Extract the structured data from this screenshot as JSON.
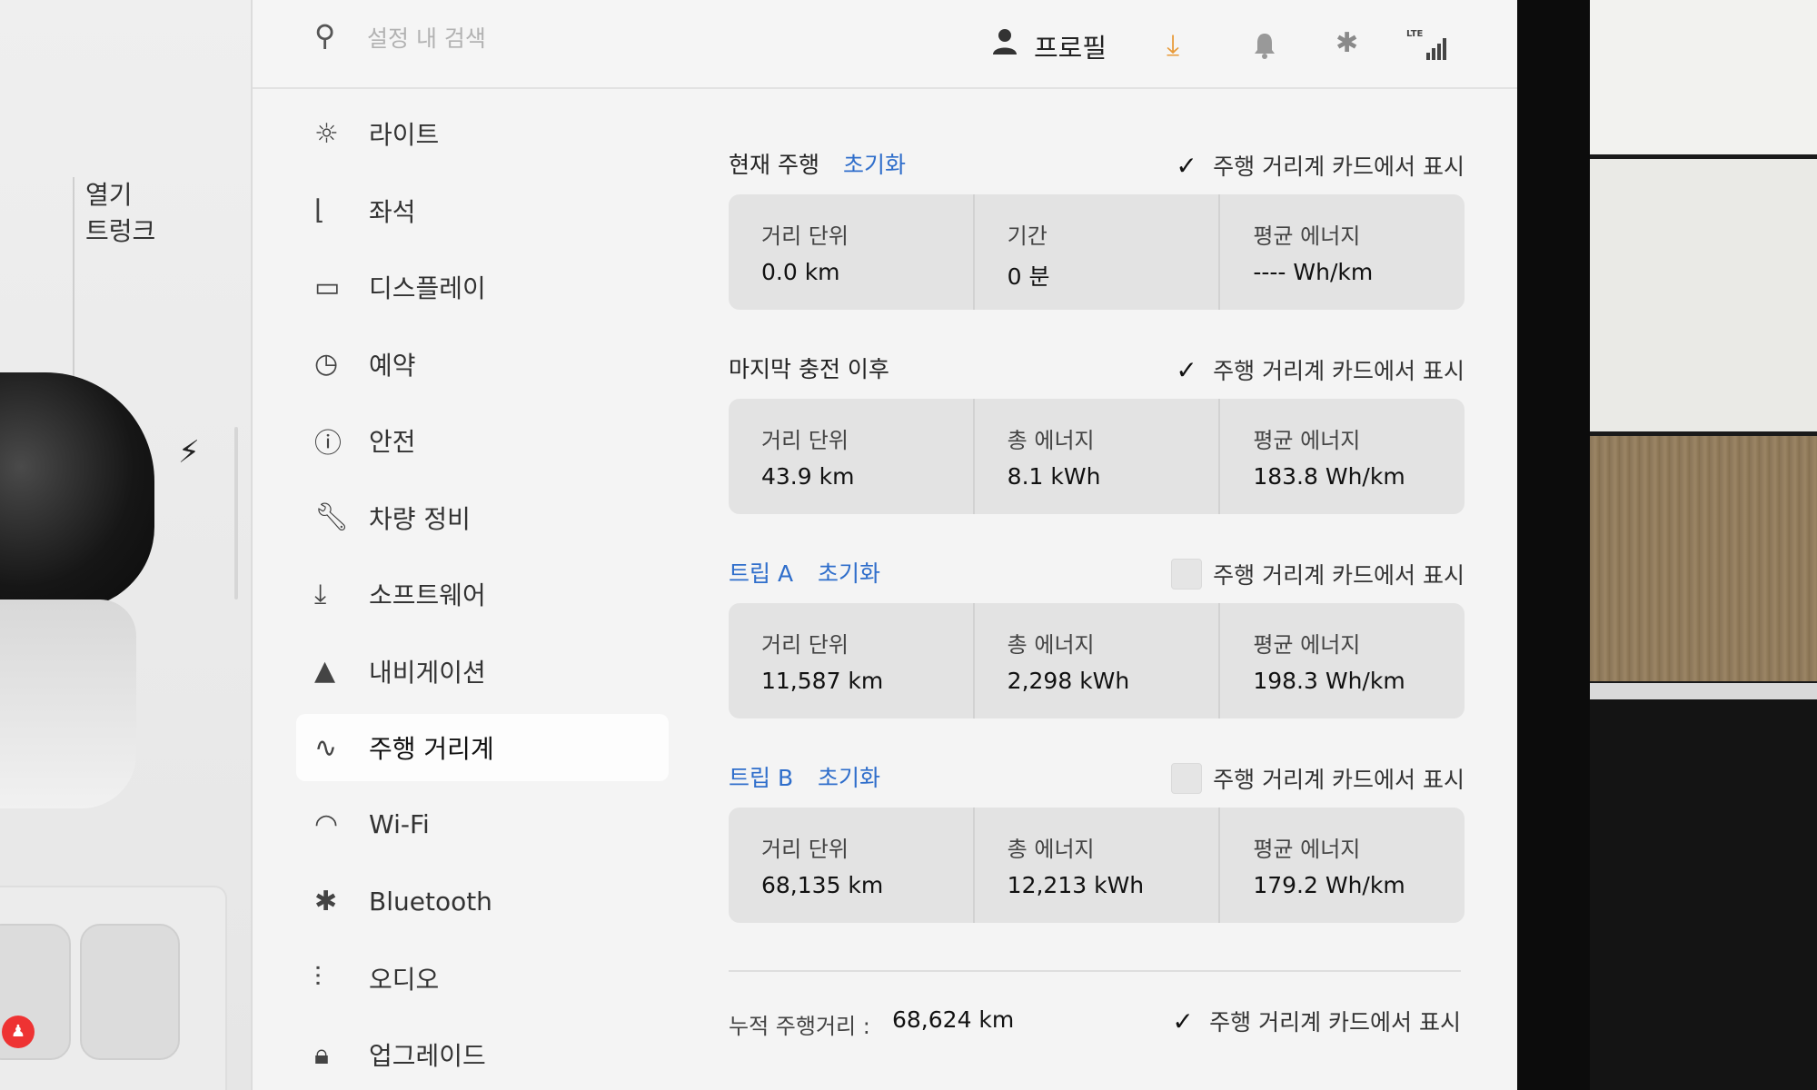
{
  "car_pane": {
    "open_label": "열기",
    "trunk_label": "트렁크"
  },
  "topbar": {
    "search_placeholder": "설정 내 검색",
    "profile_label": "프로필"
  },
  "sidebar": {
    "items": [
      {
        "label": "라이트",
        "icon": "light-icon"
      },
      {
        "label": "좌석",
        "icon": "seat-icon"
      },
      {
        "label": "디스플레이",
        "icon": "display-icon"
      },
      {
        "label": "예약",
        "icon": "schedule-icon"
      },
      {
        "label": "안전",
        "icon": "safety-icon"
      },
      {
        "label": "차량 정비",
        "icon": "wrench-icon"
      },
      {
        "label": "소프트웨어",
        "icon": "download-icon"
      },
      {
        "label": "내비게이션",
        "icon": "navigation-icon"
      },
      {
        "label": "주행 거리계",
        "icon": "trips-icon"
      },
      {
        "label": "Wi-Fi",
        "icon": "wifi-icon"
      },
      {
        "label": "Bluetooth",
        "icon": "bluetooth-icon"
      },
      {
        "label": "오디오",
        "icon": "audio-icon"
      },
      {
        "label": "업그레이드",
        "icon": "lock-icon"
      }
    ],
    "active_index": 8
  },
  "trips": {
    "show_label": "주행 거리계 카드에서 표시",
    "reset_label": "초기화",
    "current": {
      "title": "현재 주행",
      "checked": true,
      "stats": [
        {
          "label": "거리 단위",
          "value": "0.0 km"
        },
        {
          "label": "기간",
          "value": "0 분"
        },
        {
          "label": "평균 에너지",
          "value": "---- Wh/km"
        }
      ]
    },
    "since_charge": {
      "title": "마지막 충전 이후",
      "checked": true,
      "stats": [
        {
          "label": "거리 단위",
          "value": "43.9 km"
        },
        {
          "label": "총 에너지",
          "value": "8.1 kWh"
        },
        {
          "label": "평균 에너지",
          "value": "183.8 Wh/km"
        }
      ]
    },
    "trip_a": {
      "title": "트립 A",
      "checked": false,
      "stats": [
        {
          "label": "거리 단위",
          "value": "11,587 km"
        },
        {
          "label": "총 에너지",
          "value": "2,298 kWh"
        },
        {
          "label": "평균 에너지",
          "value": "198.3 Wh/km"
        }
      ]
    },
    "trip_b": {
      "title": "트립 B",
      "checked": false,
      "stats": [
        {
          "label": "거리 단위",
          "value": "68,135 km"
        },
        {
          "label": "총 에너지",
          "value": "12,213 kWh"
        },
        {
          "label": "평균 에너지",
          "value": "179.2 Wh/km"
        }
      ]
    },
    "odometer": {
      "label": "누적 주행거리 :",
      "value": "68,624 km",
      "checked": true
    }
  },
  "colors": {
    "accent_blue": "#2f6ecb",
    "download_orange": "#e89b3a",
    "card_bg": "#e3e3e3",
    "screen_bg": "#f4f4f4"
  }
}
